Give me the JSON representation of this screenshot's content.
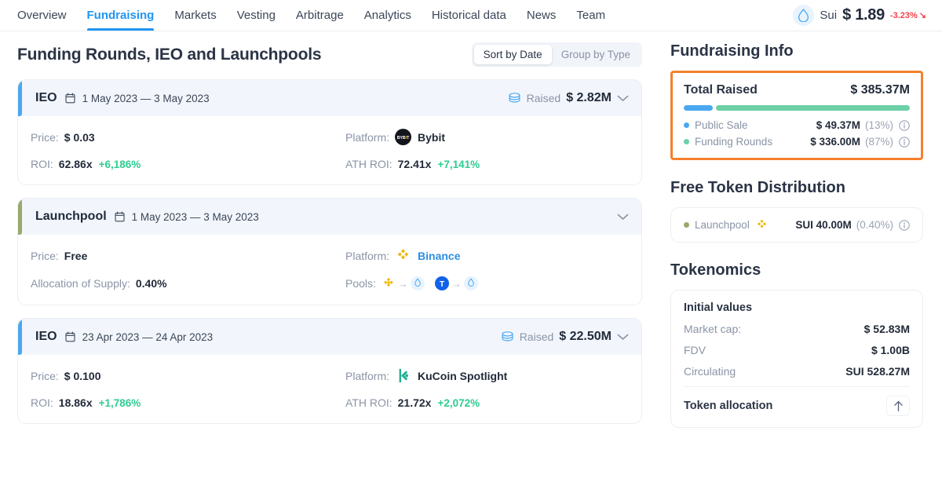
{
  "nav": {
    "items": [
      {
        "label": "Overview",
        "active": false
      },
      {
        "label": "Fundraising",
        "active": true
      },
      {
        "label": "Markets",
        "active": false
      },
      {
        "label": "Vesting",
        "active": false
      },
      {
        "label": "Arbitrage",
        "active": false
      },
      {
        "label": "Analytics",
        "active": false
      },
      {
        "label": "Historical data",
        "active": false
      },
      {
        "label": "News",
        "active": false
      },
      {
        "label": "Team",
        "active": false
      }
    ]
  },
  "ticker": {
    "icon": "sui-droplet-icon",
    "name": "Sui",
    "price": "$ 1.89",
    "change": "-3.23%",
    "change_color": "#f0434b",
    "trend": "down"
  },
  "main": {
    "title": "Funding Rounds, IEO and Launchpools",
    "sort_toggle": {
      "options": [
        "Sort by Date",
        "Group by Type"
      ],
      "selected": "Sort by Date"
    },
    "rounds": [
      {
        "type": "IEO",
        "accent": "ieo",
        "accent_color": "#4aa8f0",
        "date": "1 May 2023 — 3 May 2023",
        "raised_label": "Raised",
        "raised_value": "$ 2.82M",
        "has_raised": true,
        "price_label": "Price:",
        "price_value": "$ 0.03",
        "platform_label": "Platform:",
        "platform_name": "Bybit",
        "platform_icon": "bybit-logo",
        "metric1_label": "ROI:",
        "metric1_value": "62.86x",
        "metric1_delta": "+6,186%",
        "metric2_label": "ATH ROI:",
        "metric2_value": "72.41x",
        "metric2_delta": "+7,141%"
      },
      {
        "type": "Launchpool",
        "accent": "pool",
        "accent_color": "#9aa86a",
        "date": "1 May 2023 — 3 May 2023",
        "raised_label": "",
        "raised_value": "",
        "has_raised": false,
        "price_label": "Price:",
        "price_value": "Free",
        "platform_label": "Platform:",
        "platform_name": "Binance",
        "platform_icon": "binance-logo",
        "platform_is_link": true,
        "metric1_label": "Allocation of Supply:",
        "metric1_value": "0.40%",
        "metric1_delta": "",
        "metric2_label": "Pools:",
        "pools": [
          {
            "from_icon": "bnb-logo",
            "to_icon": "sui-droplet-icon"
          },
          {
            "from_icon": "tusd-logo",
            "to_icon": "sui-droplet-icon"
          }
        ]
      },
      {
        "type": "IEO",
        "accent": "ieo",
        "accent_color": "#4aa8f0",
        "date": "23 Apr 2023 — 24 Apr 2023",
        "raised_label": "Raised",
        "raised_value": "$ 22.50M",
        "has_raised": true,
        "price_label": "Price:",
        "price_value": "$ 0.100",
        "platform_label": "Platform:",
        "platform_name": "KuCoin Spotlight",
        "platform_icon": "kucoin-logo",
        "metric1_label": "ROI:",
        "metric1_value": "18.86x",
        "metric1_delta": "+1,786%",
        "metric2_label": "ATH ROI:",
        "metric2_value": "21.72x",
        "metric2_delta": "+2,072%"
      }
    ]
  },
  "sidebar": {
    "fundraising": {
      "title": "Fundraising Info",
      "highlight_color": "#f5802c",
      "total_label": "Total Raised",
      "total_value": "$ 385.37M",
      "segments": [
        {
          "name": "Public Sale",
          "value": "$ 49.37M",
          "pct": "(13%)",
          "pct_num": 13,
          "color": "#4aa8f0"
        },
        {
          "name": "Funding Rounds",
          "value": "$ 336.00M",
          "pct": "(87%)",
          "pct_num": 87,
          "color": "#6ccfa6"
        }
      ]
    },
    "free_token": {
      "title": "Free Token Distribution",
      "rows": [
        {
          "name": "Launchpool",
          "icon": "binance-logo",
          "value": "SUI 40.00M",
          "pct": "(0.40%)",
          "dot_color": "#9aa86a"
        }
      ]
    },
    "tokenomics": {
      "title": "Tokenomics",
      "initial_values_label": "Initial values",
      "rows": [
        {
          "key": "Market cap:",
          "value": "$ 52.83M"
        },
        {
          "key": "FDV",
          "value": "$ 1.00B"
        },
        {
          "key": "Circulating",
          "value": "SUI 528.27M"
        }
      ],
      "allocation_label": "Token allocation",
      "allocation_toggle_icon": "arrow-up-icon"
    }
  }
}
